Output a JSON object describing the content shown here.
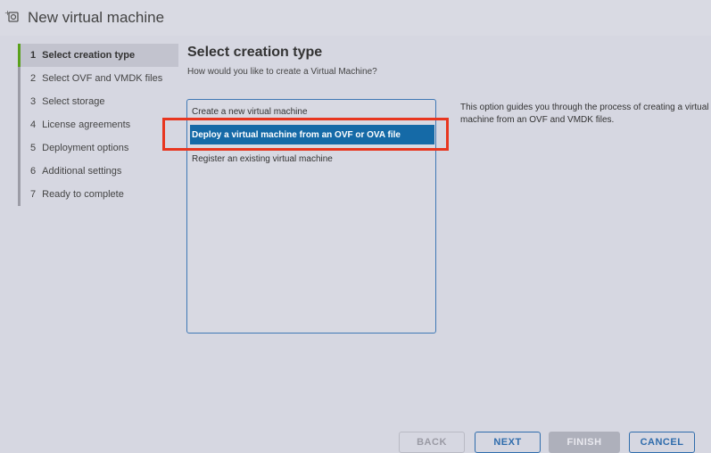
{
  "window": {
    "title": "New virtual machine",
    "icon": "virtual-machine-add-icon"
  },
  "steps": [
    {
      "num": "1",
      "label": "Select creation type",
      "selected": true
    },
    {
      "num": "2",
      "label": "Select OVF and VMDK files",
      "selected": false
    },
    {
      "num": "3",
      "label": "Select storage",
      "selected": false
    },
    {
      "num": "4",
      "label": "License agreements",
      "selected": false
    },
    {
      "num": "5",
      "label": "Deployment options",
      "selected": false
    },
    {
      "num": "6",
      "label": "Additional settings",
      "selected": false
    },
    {
      "num": "7",
      "label": "Ready to complete",
      "selected": false
    }
  ],
  "main": {
    "heading": "Select creation type",
    "subheading": "How would you like to create a Virtual Machine?",
    "options": [
      {
        "label": "Create a new virtual machine",
        "selected": false
      },
      {
        "label": "Deploy a virtual machine from an OVF or OVA file",
        "selected": true
      },
      {
        "label": "Register an existing virtual machine",
        "selected": false
      }
    ],
    "description": "This option guides you through the process of creating a virtual machine from an OVF and VMDK files."
  },
  "buttons": {
    "back": "BACK",
    "next": "NEXT",
    "finish": "FINISH",
    "cancel": "CANCEL"
  },
  "colors": {
    "accent": "#156aa7",
    "active_step": "#5aa11b",
    "annotation_box": "#e8361f"
  }
}
